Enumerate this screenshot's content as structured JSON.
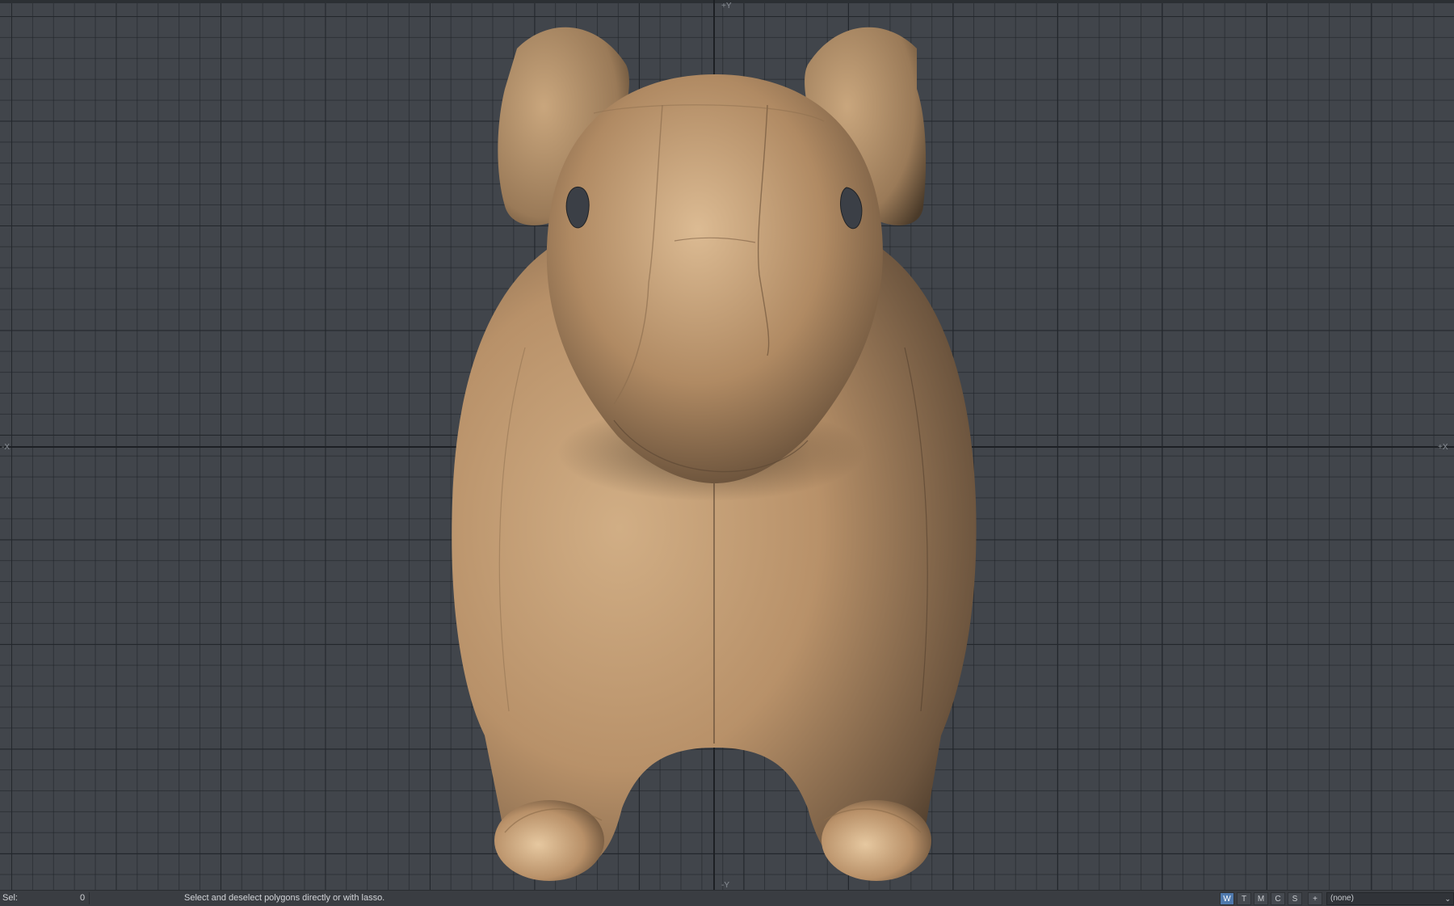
{
  "viewport": {
    "axis_labels": {
      "top": "+Y",
      "bottom": "-Y",
      "left": "-X",
      "right": "+X"
    },
    "colors": {
      "background": "#41454b",
      "grid": "#23272c",
      "model": "#c39f76"
    }
  },
  "statusbar": {
    "sel_label": "Sel:",
    "sel_count": "0",
    "hint": "Select and deselect polygons directly or with lasso.",
    "modes": [
      "W",
      "T",
      "M",
      "C",
      "S"
    ],
    "active_mode": "W",
    "add_label": "+",
    "vmap_value": "(none)",
    "vmap_arrow": "⌄"
  }
}
